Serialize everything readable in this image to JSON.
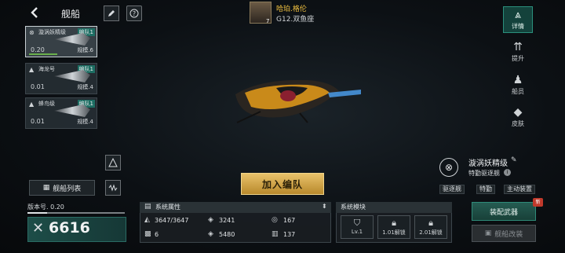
{
  "header": {
    "back_icon": "chevron-left-icon",
    "title": "舰船",
    "edit_icon": "pencil-icon",
    "help_icon": "question-icon"
  },
  "commander": {
    "name": "哈珀.格伦",
    "info": "G12.双鱼座",
    "level": "7"
  },
  "ship_list": [
    {
      "name": "漩涡妖精级",
      "team": "编队1",
      "ratio": "0.20",
      "scale": "规模.6",
      "selected": true
    },
    {
      "name": "海龙号",
      "team": "编队1",
      "ratio": "0.01",
      "scale": "规模.4",
      "selected": false
    },
    {
      "name": "蜂鸟级",
      "team": "编队1",
      "ratio": "0.01",
      "scale": "规模.4",
      "selected": false
    }
  ],
  "nav": {
    "details": "详情",
    "upgrade": "提升",
    "crew": "船员",
    "skin": "皮肤"
  },
  "buttons": {
    "fleet_list": "舰船列表",
    "join_fleet": "加入编队",
    "equip_weapon": "装配武器",
    "refit": "舰船改装",
    "new_badge": "新"
  },
  "ship_info": {
    "name": "漩涡妖精级",
    "subtype": "特勤驱逐舰",
    "tags": [
      "驱逐舰",
      "特勤",
      "主动装置"
    ]
  },
  "version": {
    "label": "版本号. 0.20",
    "progress": 0.2
  },
  "power": "6616",
  "attributes": {
    "title": "系统属性",
    "values": [
      "3647/3647",
      "3241",
      "167",
      "6",
      "5480",
      "137"
    ]
  },
  "modules": {
    "title": "系统模块",
    "slots": [
      "Lv.1",
      "1.01解锁",
      "2.01解锁"
    ]
  },
  "colors": {
    "accent": "#2b8f7c",
    "gold": "#e9c26a",
    "commander_name": "#f0c040"
  }
}
